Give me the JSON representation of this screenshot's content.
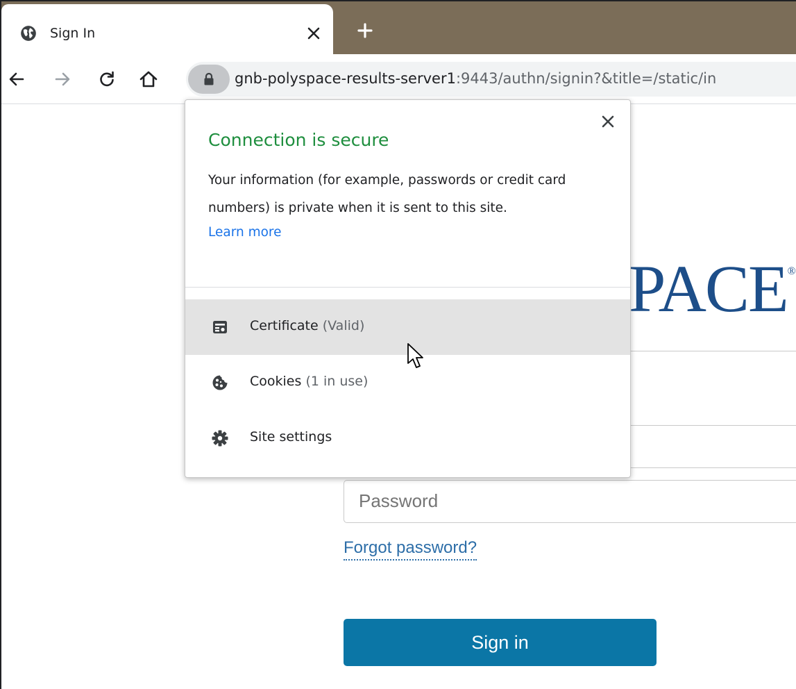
{
  "tab": {
    "title": "Sign In",
    "favicon": "globe-icon",
    "close": "close-icon",
    "new_tab": "plus-icon"
  },
  "toolbar": {
    "back": "arrow-left-icon",
    "forward": "arrow-right-icon",
    "reload": "reload-icon",
    "home": "home-icon",
    "lock": "lock-icon",
    "url_host": "gnb-polyspace-results-server1",
    "url_rest": ":9443/authn/signin?&title=/static/in"
  },
  "popup": {
    "title": "Connection is secure",
    "description": "Your information (for example, passwords or credit card numbers) is private when it is sent to this site.",
    "learn_more": "Learn more",
    "items": [
      {
        "icon": "certificate-icon",
        "label": "Certificate",
        "detail": "(Valid)"
      },
      {
        "icon": "cookie-icon",
        "label": "Cookies",
        "detail": "(1 in use)"
      },
      {
        "icon": "gear-icon",
        "label": "Site settings",
        "detail": ""
      }
    ]
  },
  "page": {
    "logo_text": "PACE",
    "logo_mark": "®",
    "password_placeholder": "Password",
    "forgot_password": "Forgot password?",
    "sign_in": "Sign in"
  },
  "colors": {
    "tabstrip": "#7b6d58",
    "secure_green": "#1e8e3e",
    "link_blue": "#1a73e8",
    "logo_blue": "#1d4e89",
    "signin_button": "#0b76a6"
  }
}
